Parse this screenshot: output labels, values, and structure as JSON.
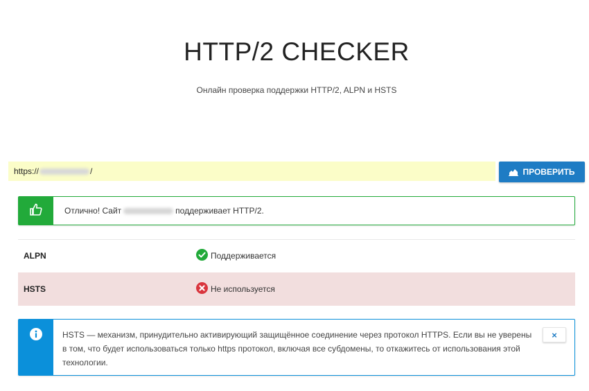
{
  "header": {
    "title": "HTTP/2 CHECKER",
    "subtitle": "Онлайн проверка поддержки HTTP/2, ALPN и HSTS"
  },
  "search": {
    "url_prefix": "https://",
    "url_suffix": "/",
    "button_label": "ПРОВЕРИТЬ",
    "button_icon": "area-chart-icon"
  },
  "result": {
    "icon": "thumbs-up-icon",
    "text_before": "Отлично! Сайт",
    "text_after": "поддерживает HTTP/2."
  },
  "checks": [
    {
      "label": "ALPN",
      "status": "Поддерживается",
      "icon": "check-circle-icon",
      "color": "#22aa3a"
    },
    {
      "label": "HSTS",
      "status": "Не используется",
      "icon": "x-circle-icon",
      "color": "#d9363e"
    }
  ],
  "info": {
    "icon": "info-icon",
    "text": "HSTS — механизм, принудительно активирующий защищённое соединение через протокол HTTPS. Если вы не уверены в том, что будет использоваться только https протокол, включая все субдомены, то откажитесь от использования этой технологии.",
    "close_label": "×"
  },
  "colors": {
    "accent": "#1e7cc4",
    "success": "#22aa3a",
    "info": "#0b90da",
    "input_bg": "#fbfdc8",
    "danger_row": "#f2dede"
  }
}
